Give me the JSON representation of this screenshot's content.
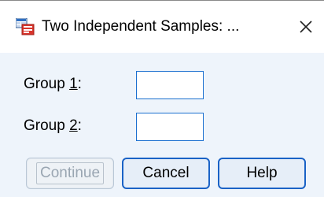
{
  "window": {
    "title": "Two Independent Samples: ...",
    "app_icon": "spss-dialog-icon",
    "close_icon": "close-icon"
  },
  "fields": {
    "group1": {
      "label_prefix": "Group ",
      "label_mnemonic": "1",
      "label_suffix": ":",
      "value": ""
    },
    "group2": {
      "label_prefix": "Group ",
      "label_mnemonic": "2",
      "label_suffix": ":",
      "value": ""
    }
  },
  "buttons": {
    "continue": {
      "label": "Continue",
      "enabled": false
    },
    "cancel": {
      "label": "Cancel",
      "enabled": true
    },
    "help": {
      "label": "Help",
      "enabled": true
    }
  },
  "colors": {
    "dialog_background": "#eef4fb",
    "accent_border": "#1a62c6",
    "disabled_text": "#9aa6b2"
  }
}
